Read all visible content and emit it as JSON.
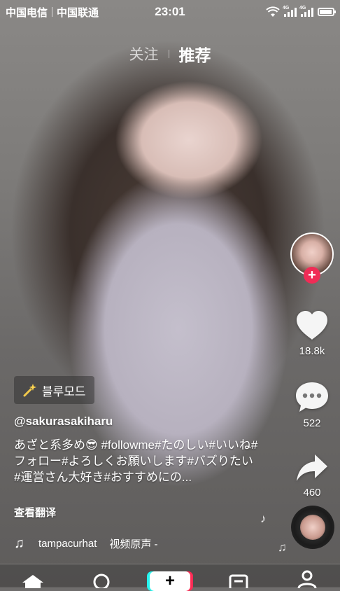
{
  "status_bar": {
    "carrier_1": "中国电信",
    "carrier_2": "中国联通",
    "time": "23:01",
    "signal_tag_1": "4G",
    "signal_tag_2": "4G",
    "battery_level": 0.85
  },
  "top_tabs": {
    "following": "关注",
    "recommended": "推荐"
  },
  "actions": {
    "likes": "18.8k",
    "comments": "522",
    "shares": "460"
  },
  "effect_label": "블루모드",
  "author": "@sakurasakiharu",
  "description": "あざと系多め😎 #followme#たのしい#いいね#フォロー#よろしくお願いします#バズりたい#運営さん大好き#おすすめにの...",
  "translate_label": "查看翻译",
  "music": {
    "artist": "tampacurhat",
    "title": "视频原声 -"
  },
  "icons": {
    "like": "heart-icon",
    "comment": "comment-icon",
    "share": "share-arrow-icon",
    "music": "music-note-icon"
  },
  "colors": {
    "accent_red": "#f02c56",
    "plus_cyan": "#25f4ee",
    "plus_pink": "#fe2c55"
  }
}
